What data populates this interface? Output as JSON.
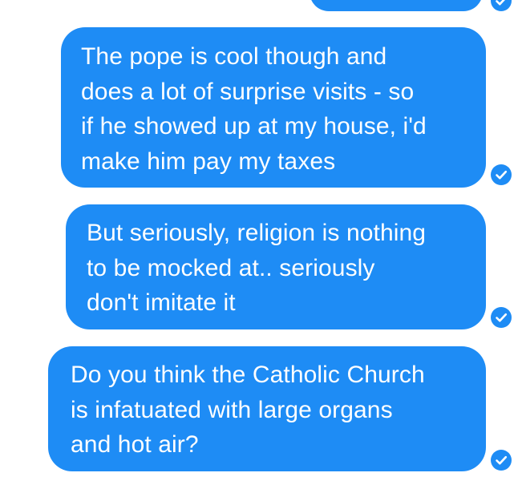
{
  "conversation": {
    "messages": [
      {
        "text": "",
        "status": "sent-check-icon"
      },
      {
        "text": "The pope is cool though and\ndoes a lot of surprise visits - so\nif he showed up at my house, i'd\nmake him pay my taxes",
        "status": "sent-check-icon"
      },
      {
        "text": "But seriously, religion is nothing\nto be mocked at..  seriously\ndon't imitate it",
        "status": "sent-check-icon"
      },
      {
        "text": "Do you think the Catholic Church\nis infatuated with large organs\nand hot air?",
        "status": "sent-check-icon"
      }
    ]
  },
  "colors": {
    "bubble": "#1e8cf5",
    "text": "#ffffff",
    "background": "#ffffff"
  }
}
